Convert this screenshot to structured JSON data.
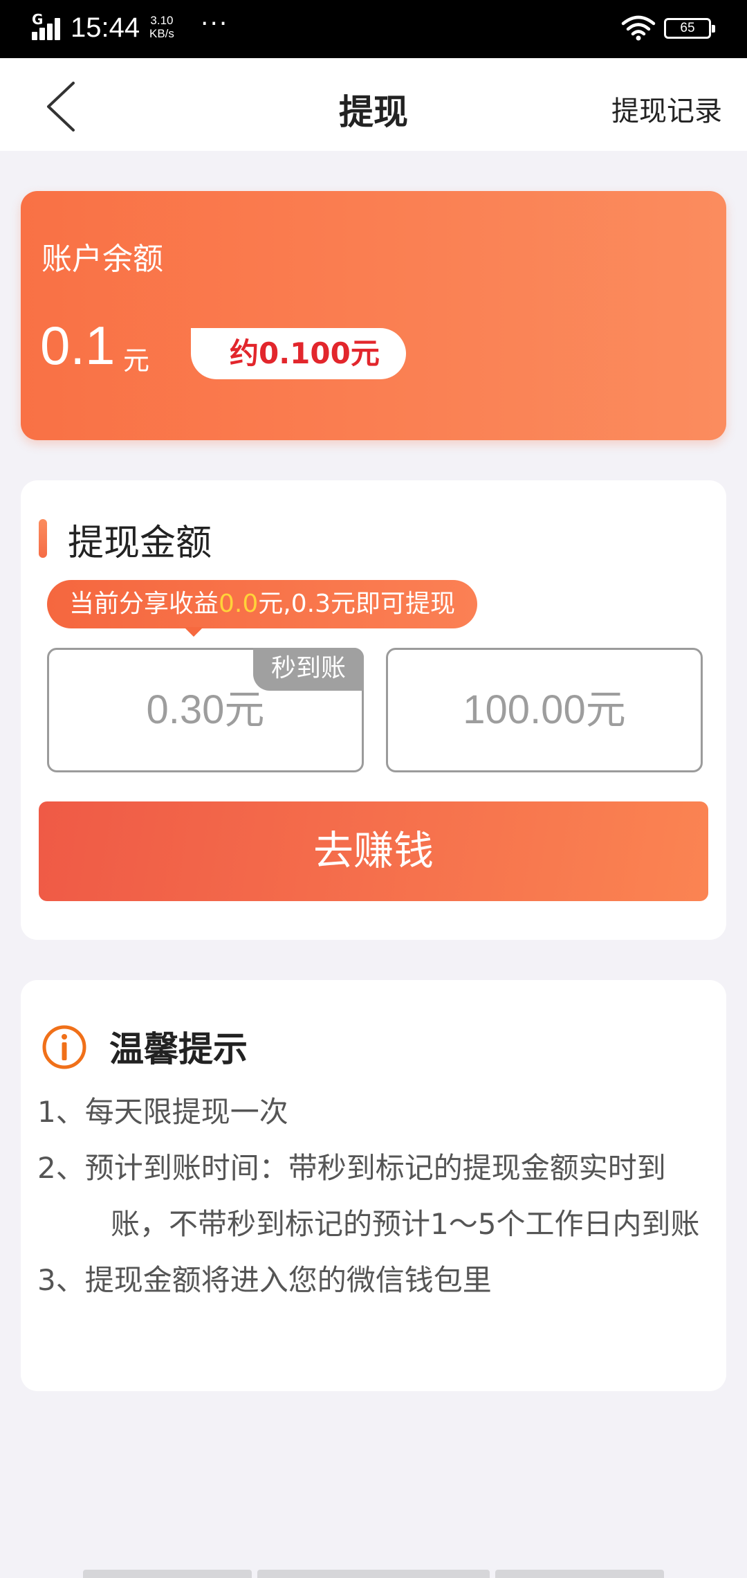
{
  "status_bar": {
    "network": "G",
    "time": "15:44",
    "speed_value": "3.10",
    "speed_unit": "KB/s",
    "more": "···",
    "battery": "65"
  },
  "nav": {
    "title": "提现",
    "record_link": "提现记录"
  },
  "balance": {
    "label": "账户余额",
    "value": "0.1",
    "unit": "元",
    "approx": "约0.100元"
  },
  "withdraw": {
    "title": "提现金额",
    "tip_prefix": "当前分享收益",
    "tip_amount": "0.0",
    "tip_suffix": "元,0.3元即可提现",
    "options": [
      {
        "amount": "0.30元",
        "badge": "秒到账"
      },
      {
        "amount": "100.00元"
      }
    ],
    "earn_button": "去赚钱"
  },
  "tips": {
    "title": "温馨提示",
    "items": [
      "1、每天限提现一次",
      "2、预计到账时间：带秒到标记的提现金额实时到账，不带秒到标记的预计1～5个工作日内到账",
      "3、提现金额将进入您的微信钱包里"
    ]
  },
  "colors": {
    "accent": "#f97145",
    "highlight": "#ffd33a",
    "approx_text": "#e2262c",
    "background": "#f3f2f7"
  },
  "icons": [
    "signal-icon",
    "wifi-icon",
    "battery-icon",
    "back-arrow-icon",
    "info-icon"
  ]
}
